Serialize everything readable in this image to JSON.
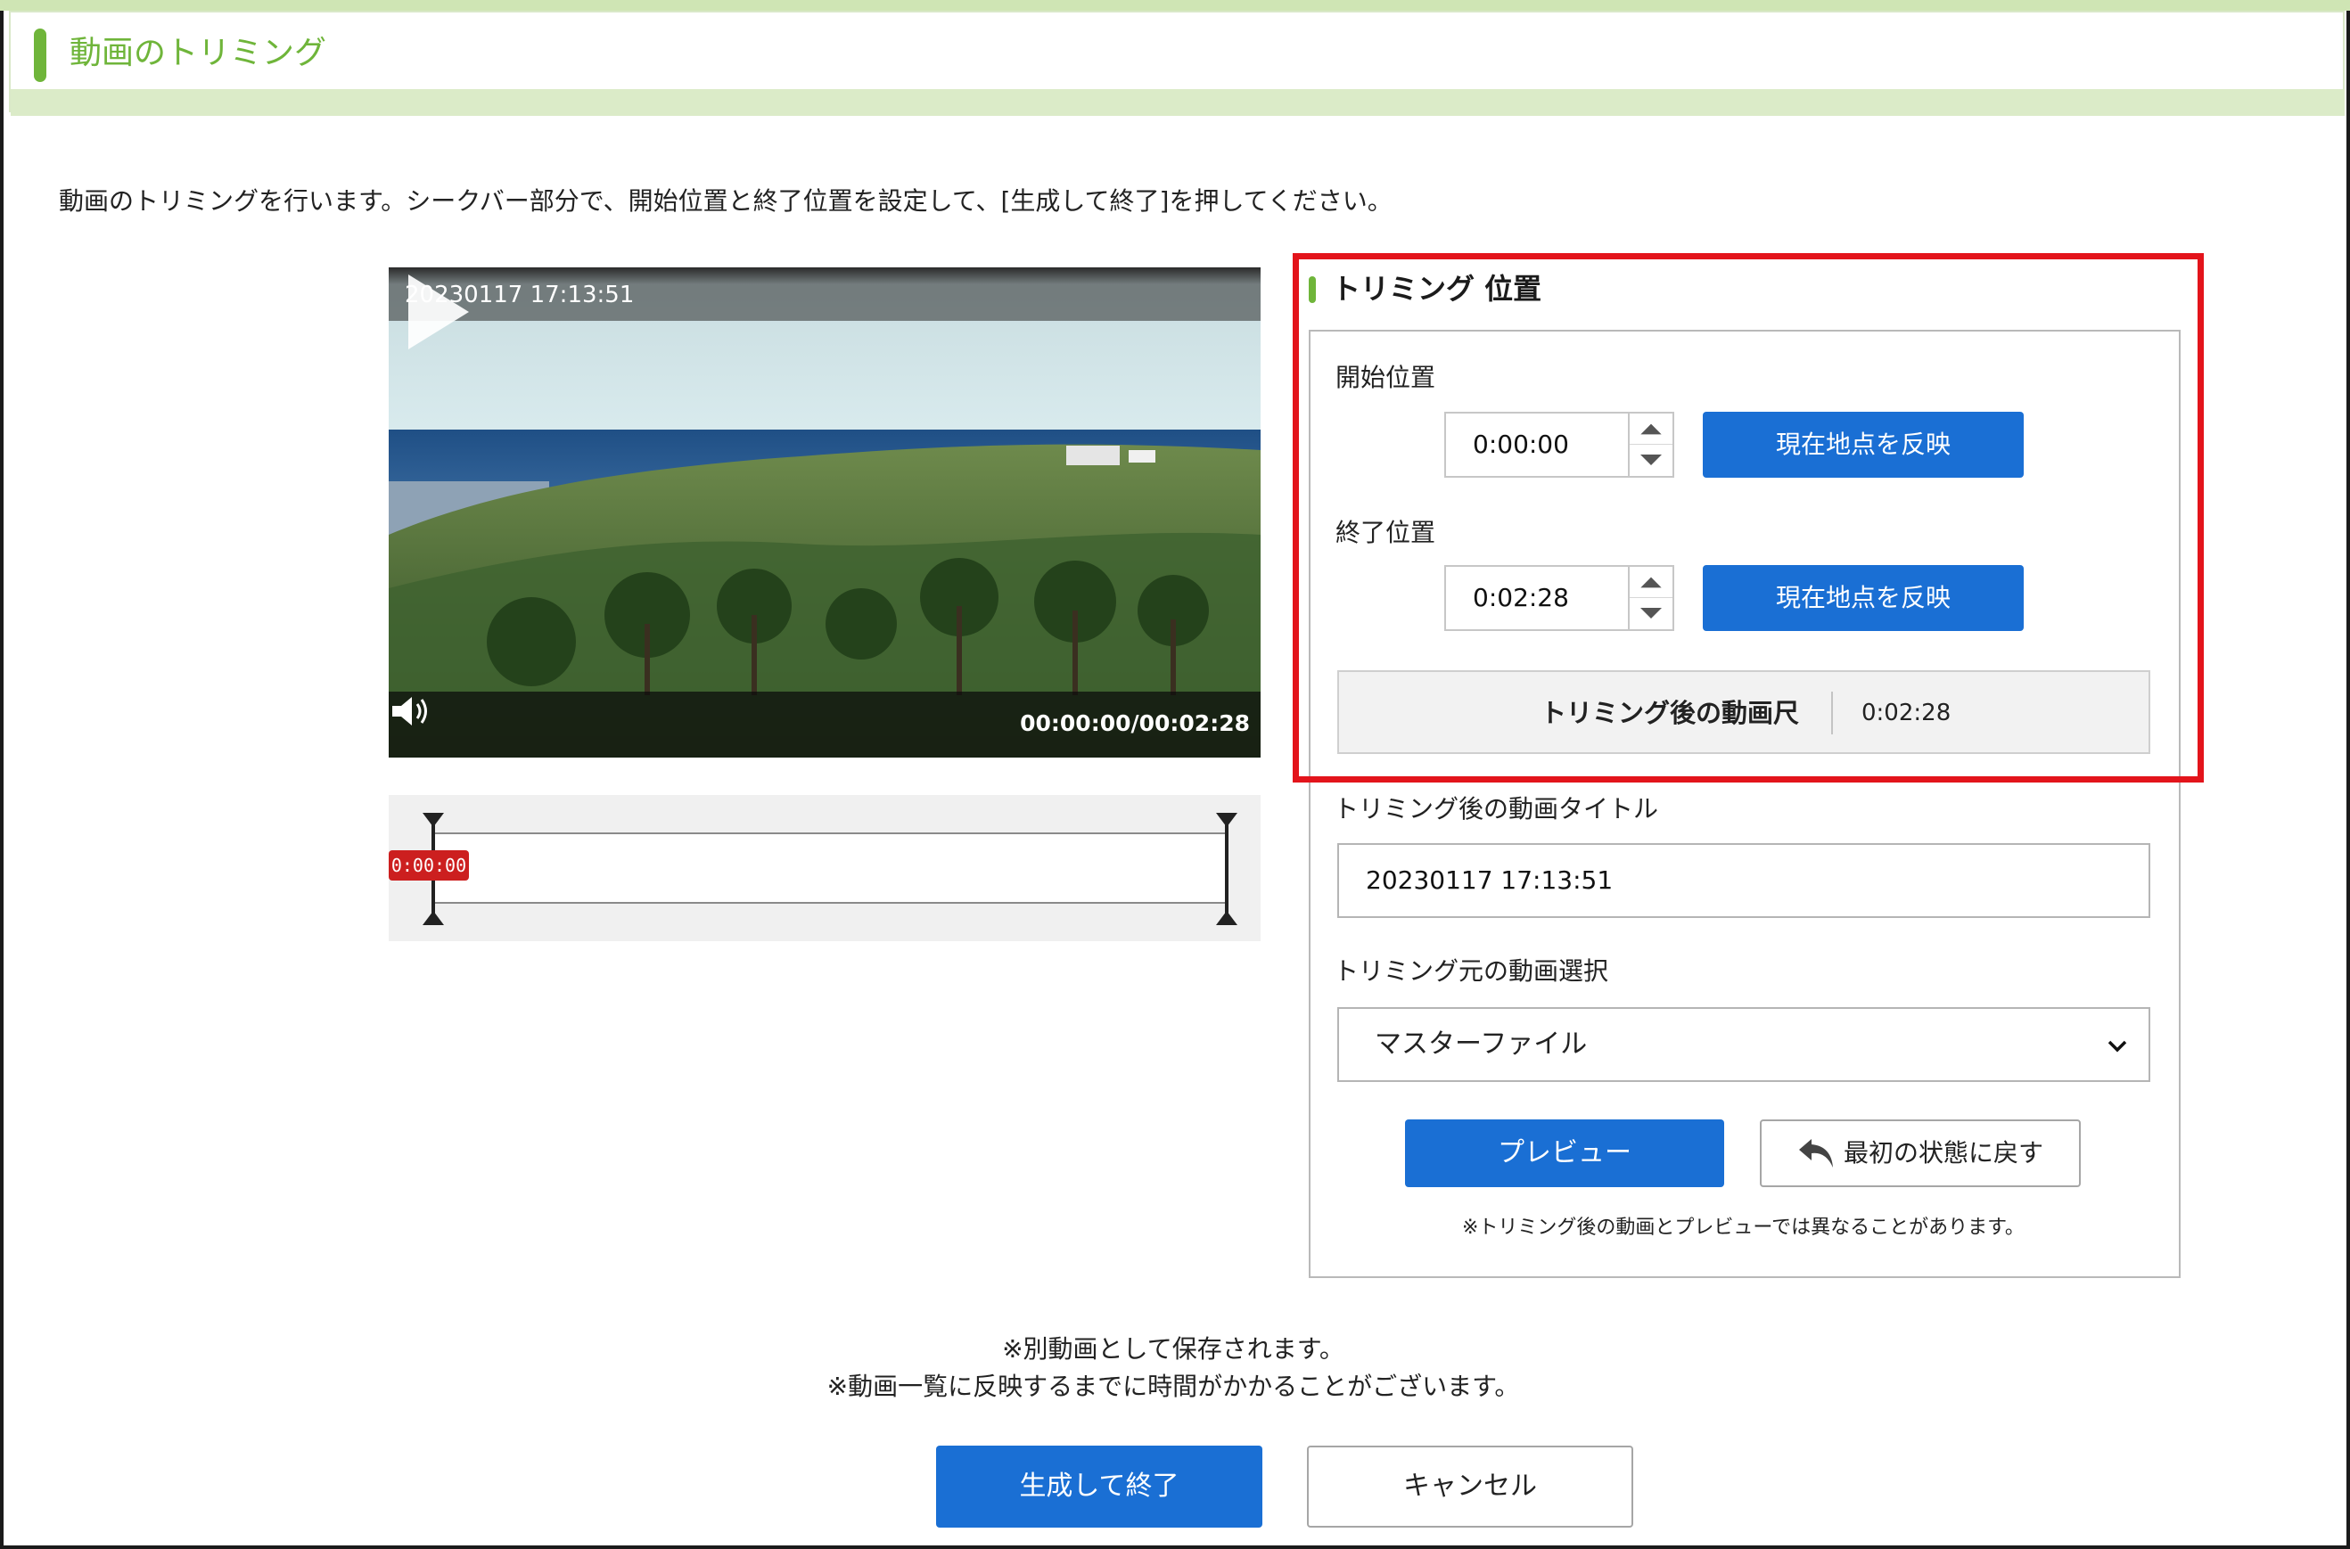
{
  "header": {
    "title": "動画のトリミング"
  },
  "intro_text": "動画のトリミングを行います。シークバー部分で、開始位置と終了位置を設定して、[生成して終了]を押してください。",
  "player": {
    "datetime_overlay": "20230117 17:13:51",
    "time_display": "00:00:00/00:02:28",
    "play_icon": "play-icon",
    "volume_icon": "volume-icon"
  },
  "seekbar": {
    "current_badge": "0:00:00",
    "start_position_fraction": 0,
    "end_position_fraction": 1
  },
  "trim_position": {
    "section_title": "トリミング 位置",
    "start_label": "開始位置",
    "start_value": "0:00:00",
    "end_label": "終了位置",
    "end_value": "0:02:28",
    "reflect_button_label": "現在地点を反映",
    "duration_label": "トリミング後の動画尺",
    "duration_value": "0:02:28"
  },
  "title_field": {
    "label": "トリミング後の動画タイトル",
    "value": "20230117 17:13:51"
  },
  "source_select": {
    "label": "トリミング元の動画選択",
    "selected": "マスターファイル"
  },
  "actions": {
    "preview_label": "プレビュー",
    "reset_label": "最初の状態に戻す",
    "preview_note": "※トリミング後の動画とプレビューでは異なることがあります。"
  },
  "footer": {
    "note_line1": "※別動画として保存されます。",
    "note_line2": "※動画一覧に反映するまでに時間がかかることがございます。",
    "generate_label": "生成して終了",
    "cancel_label": "キャンセル"
  },
  "colors": {
    "accent_green": "#6fb53a",
    "primary_blue": "#1a6fd4",
    "highlight_red": "#e3141b",
    "seek_badge_red": "#cc1f1f"
  }
}
